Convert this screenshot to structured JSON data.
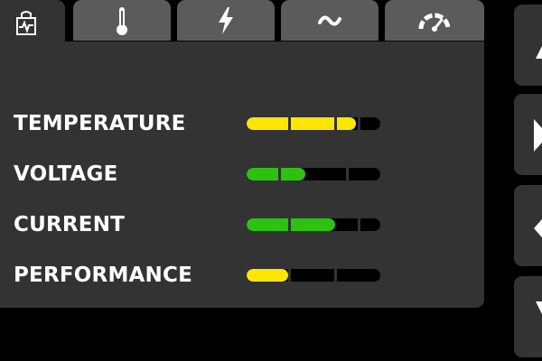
{
  "tabs": [
    {
      "name": "status-icon",
      "active": true
    },
    {
      "name": "thermometer-icon",
      "active": false
    },
    {
      "name": "lightning-icon",
      "active": false
    },
    {
      "name": "wave-icon",
      "active": false
    },
    {
      "name": "gauge-icon",
      "active": false
    }
  ],
  "rows": [
    {
      "label": "TEMPERATURE",
      "level": 0.82,
      "color": "#ffe600"
    },
    {
      "label": "VOLTAGE",
      "level": 0.44,
      "color": "#2cc20f"
    },
    {
      "label": "CURRENT",
      "level": 0.66,
      "color": "#2cc20f"
    },
    {
      "label": "PERFORMANCE",
      "level": 0.31,
      "color": "#ffe600"
    }
  ],
  "side_buttons": [
    "up-arrow-icon",
    "right-arrow-icon",
    "left-arrow-icon",
    "down-arrow-icon"
  ],
  "colors": {
    "background": "#000000",
    "panel": "#333333",
    "tab_inactive": "#5b5b5b",
    "text": "#ffffff",
    "yellow": "#ffe600",
    "green": "#2cc20f"
  }
}
